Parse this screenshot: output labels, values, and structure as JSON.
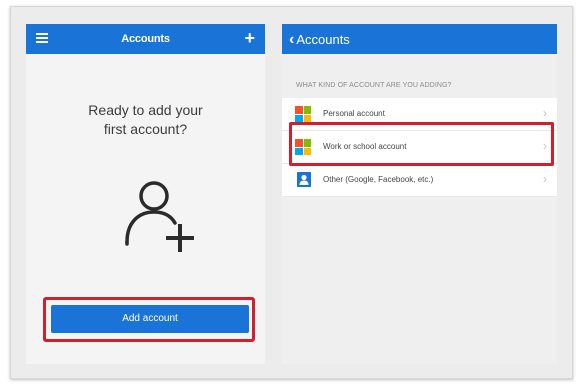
{
  "left_screen": {
    "title": "Accounts",
    "add_icon_glyph": "+",
    "prompt_line1": "Ready to add your",
    "prompt_line2": "first account?",
    "add_button_label": "Add account",
    "icons": [
      "menu-icon",
      "plus-icon",
      "add-person-icon"
    ]
  },
  "right_screen": {
    "back_label": "Accounts",
    "section_label": "WHAT KIND OF ACCOUNT ARE YOU ADDING?",
    "options": [
      {
        "label": "Personal account",
        "icon": "microsoft-logo-icon"
      },
      {
        "label": "Work or school account",
        "icon": "microsoft-logo-icon",
        "highlighted": true
      },
      {
        "label": "Other (Google, Facebook, etc.)",
        "icon": "contact-card-icon"
      }
    ],
    "arrow_glyph": "›"
  },
  "colors": {
    "accent": "#1a73d6",
    "highlight": "#d0202c"
  }
}
